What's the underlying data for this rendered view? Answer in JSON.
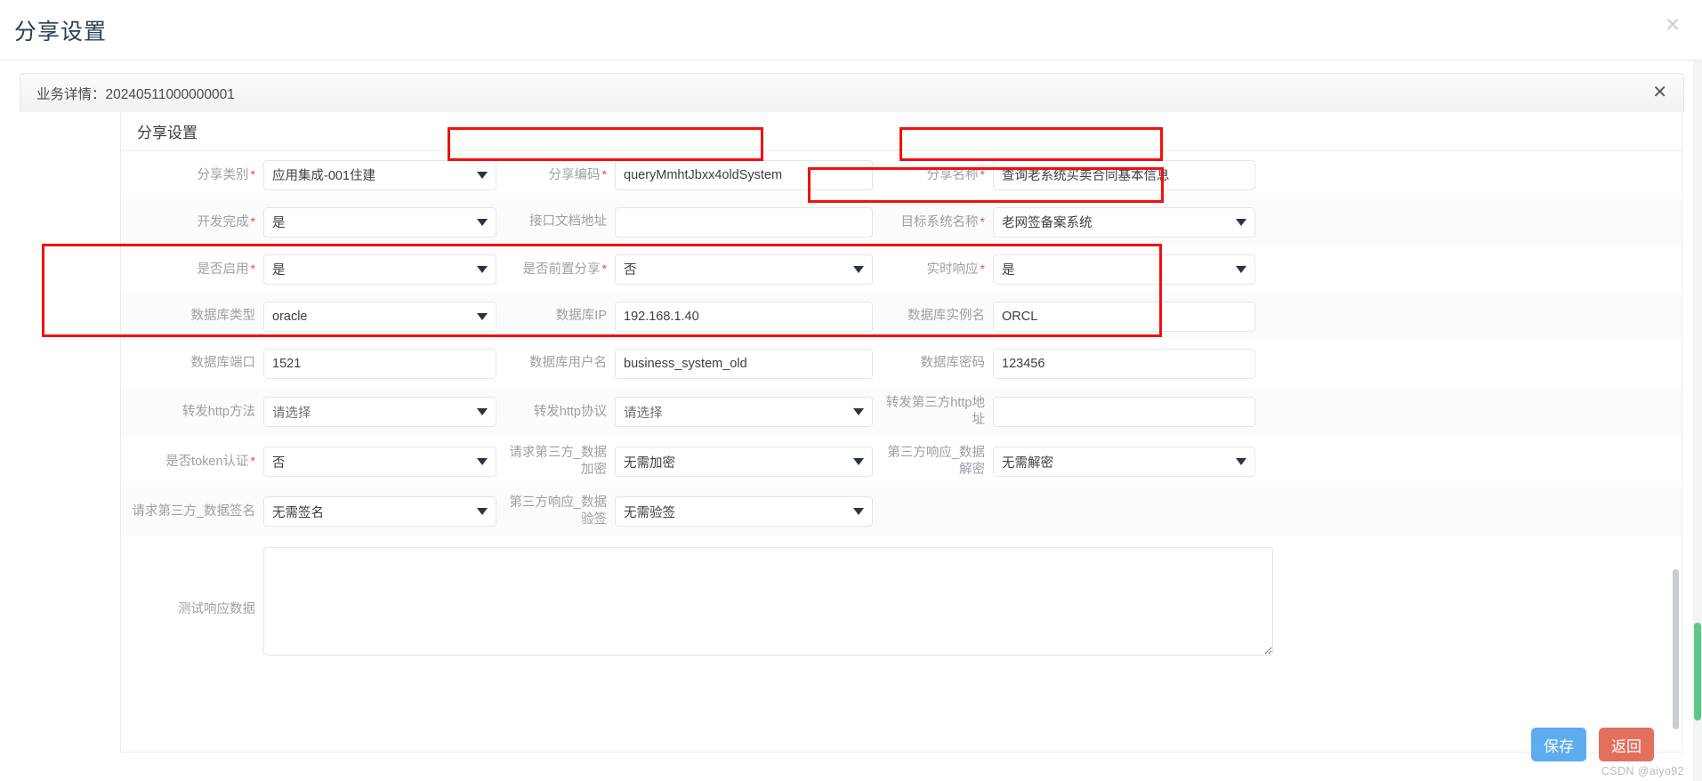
{
  "dialog": {
    "title": "分享设置",
    "close_icon": "close-icon"
  },
  "business_tab": {
    "label": "业务详情：20240511000000001",
    "close_icon": "close-icon"
  },
  "card": {
    "title": "分享设置"
  },
  "form": {
    "rows": [
      {
        "cells": [
          {
            "label": "分享类别",
            "required": true,
            "type": "select",
            "value": "应用集成-001住建"
          },
          {
            "label": "分享编码",
            "required": true,
            "type": "input",
            "value": "queryMmhtJbxx4oldSystem"
          },
          {
            "label": "分享名称",
            "required": true,
            "type": "input",
            "value": "查询老系统买卖合同基本信息"
          }
        ]
      },
      {
        "cells": [
          {
            "label": "开发完成",
            "required": true,
            "type": "select",
            "value": "是"
          },
          {
            "label": "接口文档地址",
            "required": false,
            "type": "input",
            "value": ""
          },
          {
            "label": "目标系统名称",
            "required": true,
            "type": "select",
            "value": "老网签备案系统"
          }
        ]
      },
      {
        "cells": [
          {
            "label": "是否启用",
            "required": true,
            "type": "select",
            "value": "是"
          },
          {
            "label": "是否前置分享",
            "required": true,
            "type": "select",
            "value": "否"
          },
          {
            "label": "实时响应",
            "required": true,
            "type": "select",
            "value": "是"
          }
        ]
      },
      {
        "cells": [
          {
            "label": "数据库类型",
            "required": false,
            "type": "select",
            "value": "oracle"
          },
          {
            "label": "数据库IP",
            "required": false,
            "type": "input",
            "value": "192.168.1.40"
          },
          {
            "label": "数据库实例名",
            "required": false,
            "type": "input",
            "value": "ORCL"
          }
        ]
      },
      {
        "cells": [
          {
            "label": "数据库端口",
            "required": false,
            "type": "input",
            "value": "1521"
          },
          {
            "label": "数据库用户名",
            "required": false,
            "type": "input",
            "value": "business_system_old"
          },
          {
            "label": "数据库密码",
            "required": false,
            "type": "input",
            "value": "123456"
          }
        ]
      },
      {
        "cells": [
          {
            "label": "转发http方法",
            "required": false,
            "type": "select",
            "value": "请选择",
            "is_placeholder": true
          },
          {
            "label": "转发http协议",
            "required": false,
            "type": "select",
            "value": "请选择",
            "is_placeholder": true
          },
          {
            "label": "转发第三方http地址",
            "required": false,
            "type": "input",
            "value": ""
          }
        ]
      },
      {
        "cells": [
          {
            "label": "是否token认证",
            "required": true,
            "type": "select",
            "value": "否"
          },
          {
            "label": "请求第三方_数据加密",
            "required": false,
            "type": "select",
            "value": "无需加密"
          },
          {
            "label": "第三方响应_数据解密",
            "required": false,
            "type": "select",
            "value": "无需解密"
          }
        ]
      },
      {
        "cells": [
          {
            "label": "请求第三方_数据签名",
            "required": false,
            "type": "select",
            "value": "无需签名"
          },
          {
            "label": "第三方响应_数据验签",
            "required": false,
            "type": "select",
            "value": "无需验签"
          },
          {
            "label": "",
            "required": false,
            "type": "empty",
            "value": ""
          }
        ]
      }
    ],
    "textarea": {
      "label": "测试响应数据",
      "value": "",
      "placeholder": ""
    }
  },
  "footer": {
    "save_label": "保存",
    "back_label": "返回"
  },
  "watermark": "CSDN @aiyo92",
  "colors": {
    "highlight": "#f40e0e",
    "required": "#f04a4a",
    "save": "#5cacee",
    "back": "#e2705d",
    "label": "#9ba0a6",
    "scroll_green": "#5bc88a"
  }
}
